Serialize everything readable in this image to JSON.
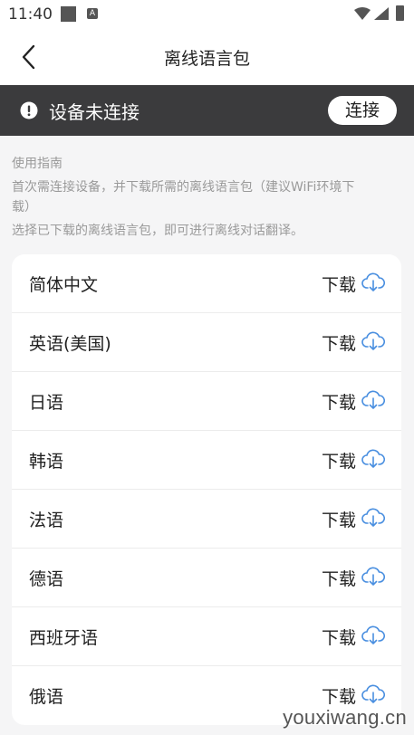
{
  "status_bar": {
    "time": "11:40",
    "notif_icon": "A"
  },
  "nav": {
    "title": "离线语言包",
    "back_icon": "chevron-left-icon"
  },
  "banner": {
    "text": "设备未连接",
    "button": "连接",
    "bg": "#3b3b3d"
  },
  "guide": {
    "title": "使用指南",
    "line1": "首次需连接设备，并下载所需的离线语言包（建议WiFi环境下",
    "line1b": "载）",
    "line2": "选择已下载的离线语言包，即可进行离线对话翻译。"
  },
  "languages": [
    {
      "name": "简体中文",
      "action": "下载"
    },
    {
      "name": "英语(美国)",
      "action": "下载"
    },
    {
      "name": "日语",
      "action": "下载"
    },
    {
      "name": "韩语",
      "action": "下载"
    },
    {
      "name": "法语",
      "action": "下载"
    },
    {
      "name": "德语",
      "action": "下载"
    },
    {
      "name": "西班牙语",
      "action": "下载"
    },
    {
      "name": "俄语",
      "action": "下载"
    }
  ],
  "watermark": "youxiwang.cn",
  "colors": {
    "accent": "#4a8fe0",
    "text": "#222222",
    "muted": "#9a9a9a"
  }
}
